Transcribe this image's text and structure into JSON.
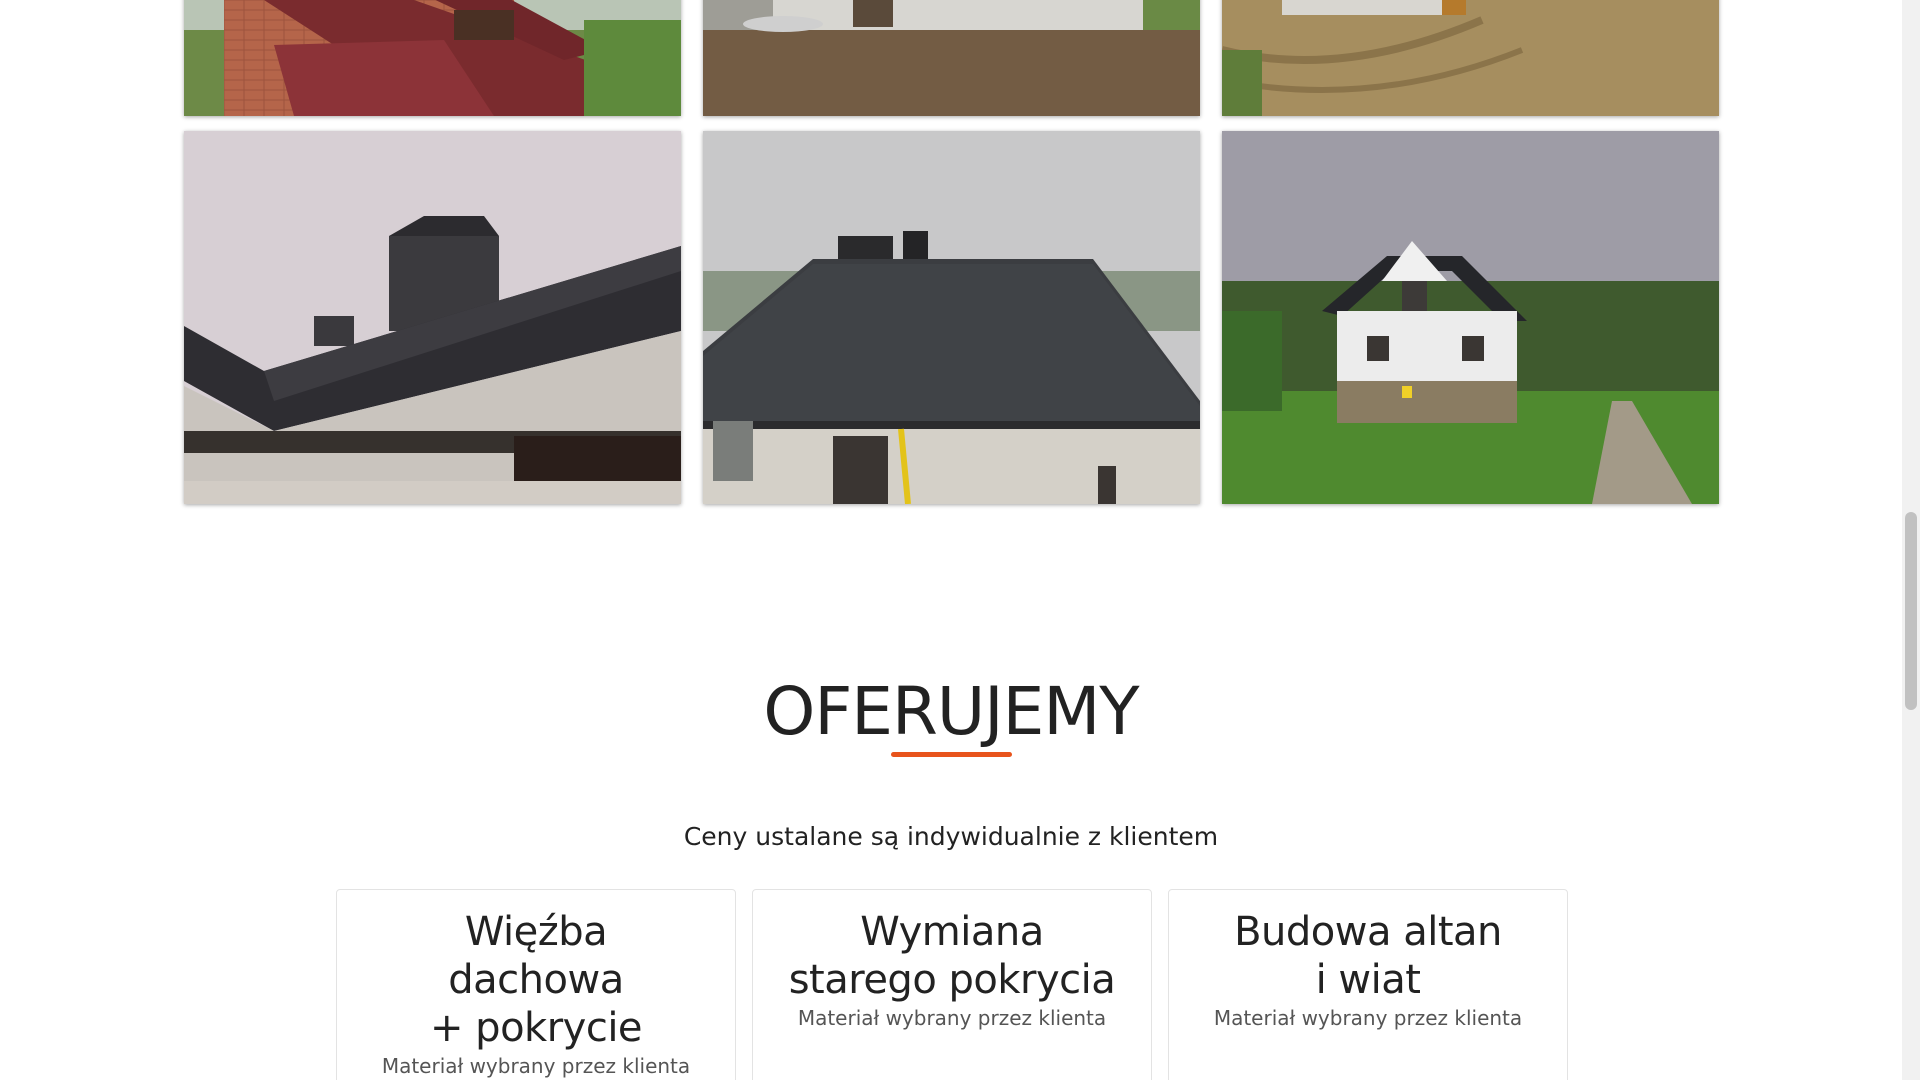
{
  "gallery": {
    "photos": [
      {
        "alt": "Dom z cegły z dachem z blachy",
        "row": 1
      },
      {
        "alt": "Budowa domu z bloczków",
        "row": 1
      },
      {
        "alt": "Teren wokół domu",
        "row": 1
      },
      {
        "alt": "Dach z blachodachówki i kominy",
        "row": 2
      },
      {
        "alt": "Kopertowy dach z blachodachówki",
        "row": 2
      },
      {
        "alt": "Ukończony dom z trawnikiem",
        "row": 2
      }
    ]
  },
  "offer": {
    "heading": "OFERUJEMY",
    "accent_color": "#e8541c",
    "subtitle": "Ceny ustalane są indywidualnie z klientem",
    "cards": [
      {
        "title": "Więźba\ndachowa\n+ pokrycie",
        "note": "Materiał wybrany przez klienta"
      },
      {
        "title": "Wymiana\nstarego pokrycia",
        "note": "Materiał wybrany przez klienta"
      },
      {
        "title": "Budowa altan\ni wiat",
        "note": "Materiał wybrany przez klienta"
      }
    ]
  }
}
